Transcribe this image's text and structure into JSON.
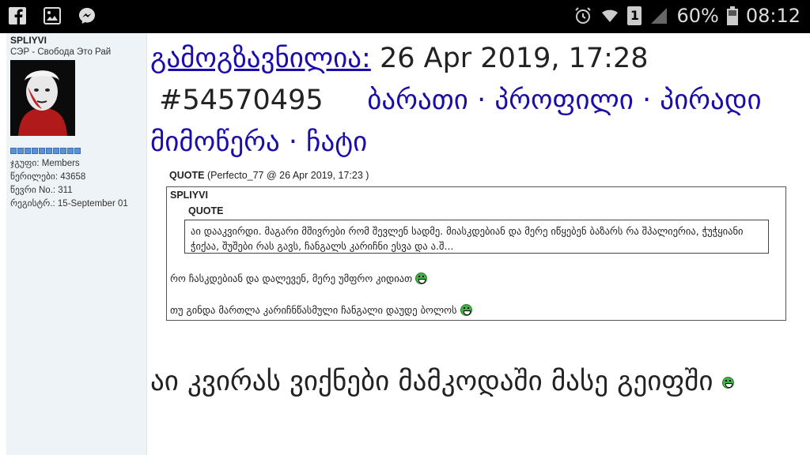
{
  "status_bar": {
    "battery": "60%",
    "time": "08:12",
    "sim": "1",
    "icons": [
      "facebook-icon",
      "gallery-icon",
      "messenger-icon",
      "alarm-icon",
      "wifi-icon",
      "sim-icon",
      "signal-icon",
      "battery-icon"
    ]
  },
  "sidebar": {
    "username": "SPLIYVI",
    "user_title": "СЭР - Свобода Это Рай",
    "info": [
      "ჯგუფი: Members",
      "წერილები: 43658",
      "წევრი No.: 311",
      "რეგისტრ.: 15-September 01"
    ]
  },
  "post": {
    "sent_label": "გამოგზავნილია:",
    "date": "26 Apr 2019, 17:28",
    "post_id": "#54570495",
    "link_card": "ბარათი",
    "link_profile": "პროფილი",
    "link_pm": "პირადი მიმოწერა",
    "link_chat": "ჩატი",
    "separator": "·",
    "body": "აი კვირას ვიქნები მამკოდაში მასე გეიფში"
  },
  "quote": {
    "label": "QUOTE",
    "meta": "(Perfecto_77 @ 26 Apr 2019, 17:23 )",
    "inner_user": "SPLIYVI",
    "inner_label": "QUOTE",
    "inner_text": "აი დააკვირდი. მაგარი მშივრები რომ შევლენ სადმე. მიასკდებიან და მერე იწყებენ ბაზარს რა შპალიერია, ჭუჭყიანი ჭიქაა, შუშები რას გავს, ჩანგალს კარიჩნი ესვა და ა.შ...",
    "reply1": "რო ჩასკდებიან და დალევენ, მერე უმფრო კიდიათ",
    "reply2": "თუ გინდა მართლა კარიჩნწასმული ჩანგალი დაუდე ბოლოს"
  },
  "colors": {
    "link": "#1a0dab",
    "sidebar_bg": "#eef3f7",
    "status_bg": "#000000"
  }
}
